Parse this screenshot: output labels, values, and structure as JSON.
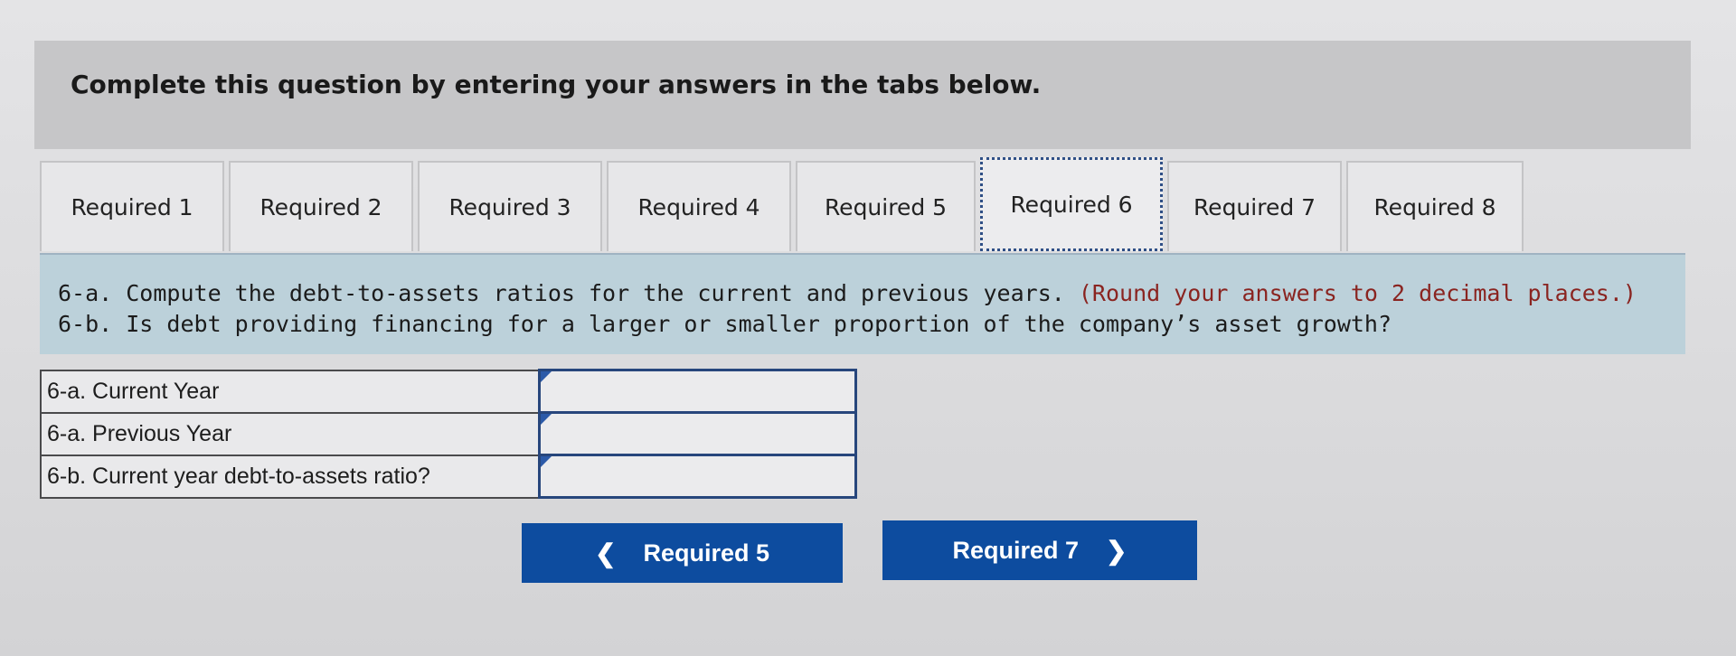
{
  "banner": {
    "text": "Complete this question by entering your answers in the tabs below."
  },
  "tabs": [
    {
      "label": "Required 1",
      "width": 204
    },
    {
      "label": "Required 2",
      "width": 204
    },
    {
      "label": "Required 3",
      "width": 204
    },
    {
      "label": "Required 4",
      "width": 204
    },
    {
      "label": "Required 5",
      "width": 199
    },
    {
      "label": "Required 6",
      "width": 202,
      "active": true
    },
    {
      "label": "Required 7",
      "width": 193
    },
    {
      "label": "Required 8",
      "width": 196
    }
  ],
  "instructions": {
    "line1": "6-a. Compute the debt-to-assets ratios for the current and previous years.",
    "line1_note": "(Round your answers to 2 decimal places.)",
    "line2": "6-b. Is debt providing financing for a larger or smaller proportion of the company’s asset growth?"
  },
  "answers": {
    "rows": [
      {
        "label": "6-a. Current Year",
        "value": ""
      },
      {
        "label": "6-a. Previous Year",
        "value": ""
      },
      {
        "label": "6-b. Current year debt-to-assets ratio?",
        "value": ""
      }
    ]
  },
  "nav": {
    "prev_label": "Required 5",
    "next_label": "Required 7",
    "prev_icon": "chevron-left-icon",
    "next_icon": "chevron-right-icon"
  },
  "colors": {
    "button_blue": "#0d4c9f",
    "instruction_bg": "#bcd1da",
    "note_red": "#8a2420"
  }
}
